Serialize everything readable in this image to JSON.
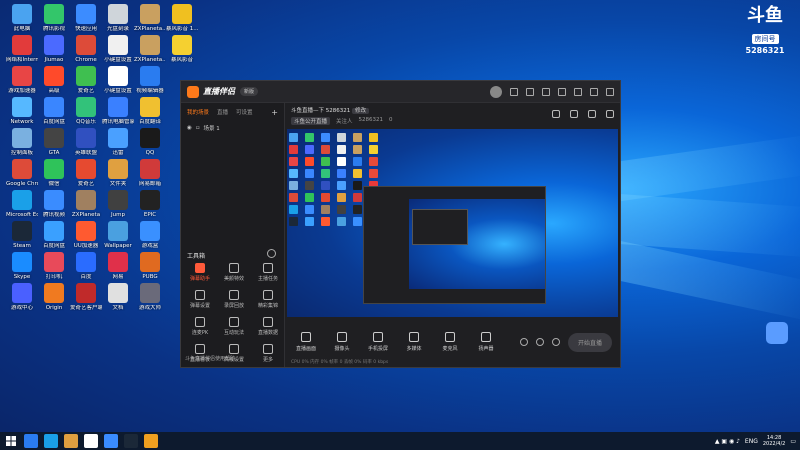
{
  "desktop": {
    "icons": [
      {
        "label": "此电脑",
        "color": "#4aa3f0"
      },
      {
        "label": "腾讯影视",
        "color": "#33c66a"
      },
      {
        "label": "快速应用",
        "color": "#3c8cff"
      },
      {
        "label": "光盘刻录",
        "color": "#cfd5da"
      },
      {
        "label": "ZXPlaneta...",
        "color": "#c9a060"
      },
      {
        "label": "暴风影音 1...",
        "color": "#f0c020"
      },
      {
        "label": "网络和Internet",
        "color": "#e23b3b"
      },
      {
        "label": "Jiumao",
        "color": "#4b6aff"
      },
      {
        "label": "Chrome",
        "color": "#dd4b39"
      },
      {
        "label": "小键盘设置",
        "color": "#f0f0f0"
      },
      {
        "label": "ZXPlaneta...",
        "color": "#c9a060"
      },
      {
        "label": "暴风影音",
        "color": "#f5d030"
      },
      {
        "label": "游戏加速器",
        "color": "#e84545"
      },
      {
        "label": "高级",
        "color": "#ff4a2a"
      },
      {
        "label": "爱奇艺",
        "color": "#3fbf50"
      },
      {
        "label": "小键盘设置",
        "color": "#ffffff"
      },
      {
        "label": "视频编辑器",
        "color": "#2a7cf0"
      },
      {
        "label": "网易游戏",
        "color": "#e64a3a"
      },
      {
        "label": "Network",
        "color": "#56b8ff"
      },
      {
        "label": "百度网盘",
        "color": "#3a86ff"
      },
      {
        "label": "QQ音乐",
        "color": "#32c27a"
      },
      {
        "label": "腾讯电脑管家",
        "color": "#3a80ff"
      },
      {
        "label": "百度翻译",
        "color": "#f0c030"
      },
      {
        "label": "网易云音乐",
        "color": "#e84a3a"
      },
      {
        "label": "控制面板",
        "color": "#7ab0e0"
      },
      {
        "label": "GTA",
        "color": "#444444"
      },
      {
        "label": "英雄联盟",
        "color": "#3050c0"
      },
      {
        "label": "迅雷",
        "color": "#4aa0ff"
      },
      {
        "label": "QQ",
        "color": "#1a1a1a"
      },
      {
        "label": "腾讯游戏",
        "color": "#e83a3a"
      },
      {
        "label": "Google Chrome",
        "color": "#dd4b39"
      },
      {
        "label": "微信",
        "color": "#2fc35a"
      },
      {
        "label": "爱奇艺",
        "color": "#e64a30"
      },
      {
        "label": "文件夹",
        "color": "#e0a040"
      },
      {
        "label": "网易邮箱",
        "color": "#d03a3a"
      },
      {
        "label": "游戏大全",
        "color": "#8a5ae0"
      },
      {
        "label": "Microsoft Edge",
        "color": "#1aa0e8"
      },
      {
        "label": "腾讯视频",
        "color": "#3a8cff"
      },
      {
        "label": "ZXPlaneta",
        "color": "#a08060"
      },
      {
        "label": "Jump",
        "color": "#404040"
      },
      {
        "label": "EPIC",
        "color": "#222222"
      },
      {
        "label": "文件",
        "color": "#ffffff"
      },
      {
        "label": "Steam",
        "color": "#1b2838"
      },
      {
        "label": "百度网盘",
        "color": "#3aa0ff"
      },
      {
        "label": "UU加速器",
        "color": "#ff5a30"
      },
      {
        "label": "Wallpaper",
        "color": "#4aa0e0"
      },
      {
        "label": "游戏盒",
        "color": "#3a90ff"
      },
      {
        "label": "暴雪",
        "color": "#ffffff"
      },
      {
        "label": "Skype",
        "color": "#1a8cff"
      },
      {
        "label": "打印机",
        "color": "#e84a5a"
      },
      {
        "label": "百度",
        "color": "#2a6cff"
      },
      {
        "label": "网易",
        "color": "#e0304a"
      },
      {
        "label": "PUBG",
        "color": "#e06a20"
      },
      {
        "label": "腾讯会议",
        "color": "#303030"
      },
      {
        "label": "游戏中心",
        "color": "#4a60ff"
      },
      {
        "label": "Origin",
        "color": "#f07a20"
      },
      {
        "label": "爱奇艺客户端",
        "color": "#c02a2a"
      },
      {
        "label": "文档",
        "color": "#e0e0e0"
      },
      {
        "label": "游戏大师",
        "color": "#6a6a7a"
      }
    ]
  },
  "douyu": {
    "logo": "斗鱼",
    "room_label": "房间号",
    "room_number": "5286321"
  },
  "app": {
    "name": "直播伴侣",
    "version": "新版",
    "sidebar_tabs": [
      "我的场景",
      "直播",
      "可设置"
    ],
    "scene_label": "场景 1",
    "tools_title": "工具箱",
    "tools": [
      {
        "label": "弹幕助手",
        "active": true
      },
      {
        "label": "美颜特效",
        "active": false
      },
      {
        "label": "主播任务",
        "active": false
      },
      {
        "label": "弹幕设置",
        "active": false
      },
      {
        "label": "录屏回放",
        "active": false
      },
      {
        "label": "精彩集锦",
        "active": false
      },
      {
        "label": "连麦PK",
        "active": false
      },
      {
        "label": "互动玩法",
        "active": false
      },
      {
        "label": "直播数据",
        "active": false
      },
      {
        "label": "直播看板",
        "active": false
      },
      {
        "label": "高级设置",
        "active": false
      },
      {
        "label": "更多",
        "active": false
      }
    ],
    "sidebar_footer": "斗鱼直播伴侣使用帮助",
    "room_title": "斗鱼直播—下 5286321",
    "room_tag": "修改",
    "room_sub": [
      "斗鱼公开直播",
      "关注人",
      "5286321"
    ],
    "room_count": "0",
    "controls": [
      "直播画面",
      "摄像头",
      "手机投屏",
      "多媒体",
      "麦克风",
      "扬声器"
    ],
    "start_button": "开始直播",
    "status_text": "CPU 0%  内存 0%  帧率 0  丢帧 0%  码率 0 kbps"
  },
  "taskbar": {
    "apps": [
      "#2a7cf0",
      "#1aa0e8",
      "#e0a040",
      "#ffffff",
      "#3a8cff",
      "#1b2838",
      "#f0a020"
    ],
    "tray_lang": "ENG",
    "time": "14:28",
    "date": "2022/4/2"
  }
}
